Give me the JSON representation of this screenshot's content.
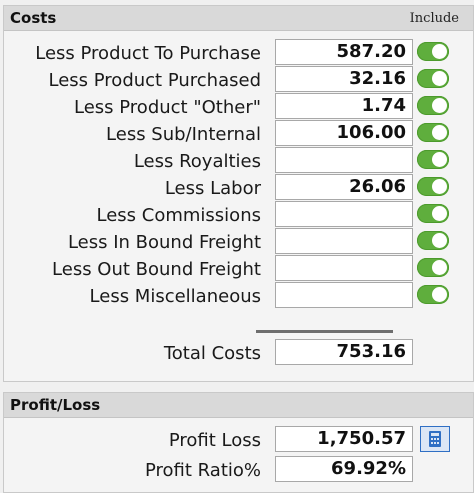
{
  "costs": {
    "title": "Costs",
    "include_label": "Include",
    "rows": [
      {
        "label": "Less Product To Purchase",
        "value": "587.20",
        "included": true
      },
      {
        "label": "Less Product Purchased",
        "value": "32.16",
        "included": true
      },
      {
        "label": "Less Product \"Other\"",
        "value": "1.74",
        "included": true
      },
      {
        "label": "Less Sub/Internal",
        "value": "106.00",
        "included": true
      },
      {
        "label": "Less Royalties",
        "value": "",
        "included": true
      },
      {
        "label": "Less Labor",
        "value": "26.06",
        "included": true
      },
      {
        "label": "Less Commissions",
        "value": "",
        "included": true
      },
      {
        "label": "Less In Bound Freight",
        "value": "",
        "included": true
      },
      {
        "label": "Less Out Bound Freight",
        "value": "",
        "included": true
      },
      {
        "label": "Less Miscellaneous",
        "value": "",
        "included": true
      }
    ],
    "total_label": "Total Costs",
    "total_value": "753.16"
  },
  "profit_loss": {
    "title": "Profit/Loss",
    "profit_loss_label": "Profit Loss",
    "profit_loss_value": "1,750.57",
    "calculator_icon": "calculator-icon",
    "profit_ratio_label": "Profit Ratio%",
    "profit_ratio_value": "69.92%"
  },
  "colors": {
    "toggle_on": "#5fae3d",
    "calculator_accent": "#2f6fc4"
  }
}
